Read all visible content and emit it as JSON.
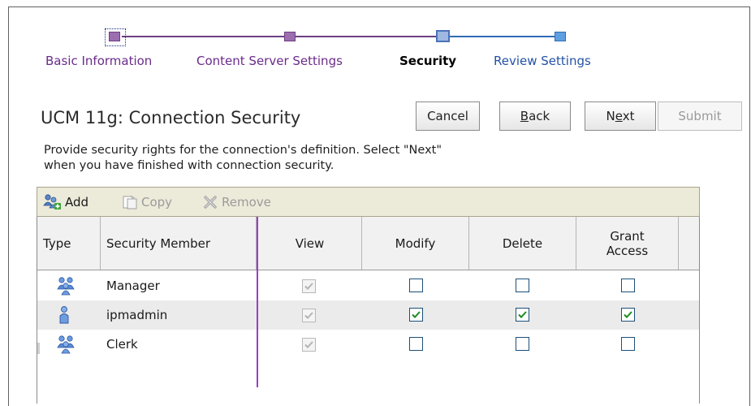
{
  "train": {
    "steps": [
      {
        "label": "Basic Information",
        "state": "visited"
      },
      {
        "label": "Content Server Settings",
        "state": "visited"
      },
      {
        "label": "Security",
        "state": "current"
      },
      {
        "label": "Review Settings",
        "state": "todo"
      }
    ]
  },
  "page": {
    "title": "UCM 11g: Connection Security",
    "description_line1": "Provide security rights for the connection's definition. Select \"Next\"",
    "description_line2": "when you have finished with connection security."
  },
  "buttons": {
    "cancel": "Cancel",
    "back": "Back",
    "next": "Next",
    "submit": "Submit"
  },
  "toolbar": {
    "add": "Add",
    "copy": "Copy",
    "remove": "Remove"
  },
  "table": {
    "headers": {
      "type": "Type",
      "member": "Security Member",
      "view": "View",
      "modify": "Modify",
      "delete": "Delete",
      "grant_line1": "Grant",
      "grant_line2": "Access"
    },
    "rows": [
      {
        "type_icon": "group-icon",
        "member": "Manager",
        "view": true,
        "modify": false,
        "delete": false,
        "grant": false
      },
      {
        "type_icon": "user-icon",
        "member": "ipmadmin",
        "view": true,
        "modify": true,
        "delete": true,
        "grant": true
      },
      {
        "type_icon": "group-icon",
        "member": "Clerk",
        "view": true,
        "modify": false,
        "delete": false,
        "grant": false
      }
    ]
  },
  "colors": {
    "visited": "#6a2c8a",
    "todo": "#2452a6",
    "check": "#1f8a1f",
    "freeze_line": "#9b3ec0"
  }
}
